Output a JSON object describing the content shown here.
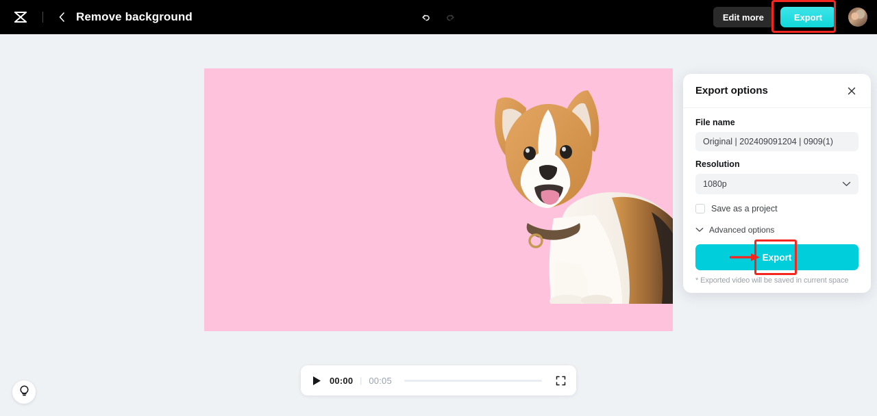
{
  "header": {
    "logo_icon": "capcut-logo-icon",
    "back_icon": "chevron-left-icon",
    "title": "Remove background",
    "undo_icon": "undo-icon",
    "redo_icon": "redo-icon",
    "edit_more_label": "Edit more",
    "export_label": "Export",
    "avatar_icon": "user-avatar"
  },
  "canvas": {
    "background_color": "#ffc2dc",
    "stage_color": "#eff2f5",
    "subject": "corgi-dog-cutout"
  },
  "player": {
    "play_icon": "play-icon",
    "current_time": "00:00",
    "separator": "|",
    "total_time": "00:05",
    "progress_percent": 0,
    "fullscreen_icon": "fullscreen-icon"
  },
  "hint": {
    "icon": "lightbulb-icon"
  },
  "panel": {
    "title": "Export options",
    "close_icon": "close-icon",
    "file_name_label": "File name",
    "file_name_value": "Original | 202409091204 | 0909(1)",
    "resolution_label": "Resolution",
    "resolution_value": "1080p",
    "resolution_chevron_icon": "chevron-down-icon",
    "save_project_label": "Save as a project",
    "save_project_checked": false,
    "advanced_options_label": "Advanced options",
    "advanced_chevron_icon": "chevron-down-icon",
    "export_button_label": "Export",
    "footnote": "* Exported video will be saved in current space"
  },
  "annotations": {
    "highlight_color": "#f5251f",
    "arrow_icon": "red-arrow-right",
    "accent_color": "#00cedb"
  }
}
